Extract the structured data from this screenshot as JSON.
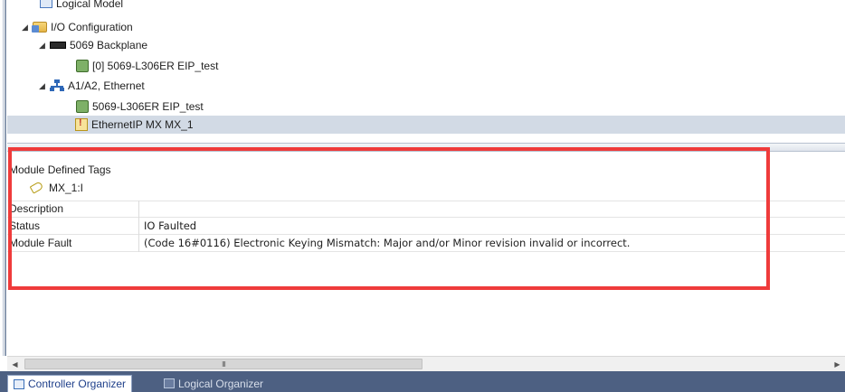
{
  "tree": {
    "items": [
      {
        "label": "Logical Model",
        "toggle": "",
        "icon": "logical-model-icon"
      },
      {
        "label": "I/O Configuration",
        "toggle": "◢",
        "icon": "io-configuration-icon"
      },
      {
        "label": "5069 Backplane",
        "toggle": "◢",
        "icon": "backplane-icon"
      },
      {
        "label": "[0] 5069-L306ER EIP_test",
        "toggle": "",
        "icon": "controller-module-icon"
      },
      {
        "label": "A1/A2, Ethernet",
        "toggle": "◢",
        "icon": "ethernet-network-icon"
      },
      {
        "label": "5069-L306ER EIP_test",
        "toggle": "",
        "icon": "controller-module-icon"
      },
      {
        "label": "EthernetIP MX MX_1",
        "toggle": "",
        "icon": "warning-module-icon"
      }
    ]
  },
  "properties": {
    "header": "Module Defined Tags",
    "tag": "MX_1:I",
    "rows": [
      {
        "name": "Description",
        "value": ""
      },
      {
        "name": "Status",
        "value": "IO Faulted"
      },
      {
        "name": "Module Fault",
        "value": "(Code 16#0116) Electronic Keying Mismatch: Major and/or Minor revision invalid or incorrect."
      }
    ]
  },
  "scrollbar": {
    "left_arrow": "◀",
    "right_arrow": "▶",
    "thumb_grip": "III"
  },
  "tabs": [
    {
      "label": "Controller Organizer",
      "active": true
    },
    {
      "label": "Logical Organizer",
      "active": false
    }
  ],
  "colors": {
    "highlight": "#ef3b3b",
    "selected_row": "#d2dae5",
    "tab_bar": "#4d6082"
  }
}
